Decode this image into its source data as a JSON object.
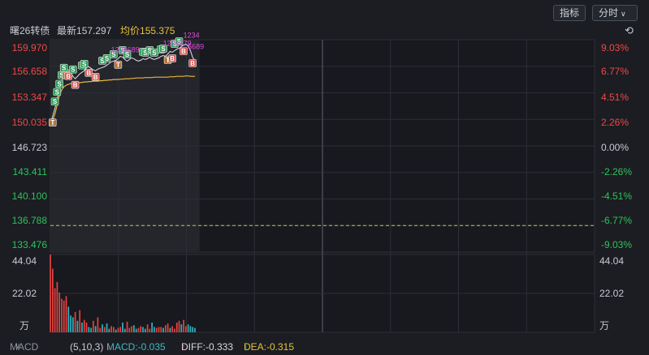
{
  "toolbar": {
    "indicator_label": "指标",
    "period_label": "分时",
    "period_icon": "chevron-down-icon"
  },
  "quote": {
    "name": "曙26转债",
    "latest_label": "最新",
    "latest_value": "157.297",
    "avg_label": "均价",
    "avg_value": "155.375",
    "refresh_icon": "refresh-icon"
  },
  "price_axis": {
    "left": [
      "159.970",
      "156.658",
      "153.347",
      "150.035",
      "146.723",
      "143.411",
      "140.100",
      "136.788",
      "133.476"
    ],
    "right": [
      "9.03%",
      "6.77%",
      "4.51%",
      "2.26%",
      "0.00%",
      "-2.26%",
      "-4.51%",
      "-6.77%",
      "-9.03%"
    ]
  },
  "volume_axis": {
    "left_top": "44.04",
    "left_mid": "22.02",
    "left_unit": "万",
    "right_top": "44.04",
    "right_mid": "22.02",
    "right_unit": "万"
  },
  "footer": {
    "indicator": "MACD",
    "indicator_icon": "chevron-down-icon",
    "params": "(5,10,3)",
    "macd": "MACD:-0.035",
    "diff": "DIFF:-0.333",
    "dea": "DEA:-0.315"
  },
  "chart_data": {
    "type": "line",
    "ylim": [
      133.476,
      159.97
    ],
    "reference_price": 146.723,
    "dashed_level": 136.788,
    "series": [
      {
        "values": [
          149.6,
          150.4,
          151.4,
          152.6,
          153.6,
          154.7,
          155.6,
          156.3,
          156.2,
          155.9,
          155.4,
          155.1,
          155.4,
          155.7,
          155.9,
          156.1,
          156.5,
          156.6,
          156.4,
          156.2,
          156.1,
          156.3,
          156.4,
          156.5,
          156.6,
          156.8,
          157.0,
          157.2,
          157.3,
          157.4,
          157.6,
          157.9,
          157.8,
          157.5,
          157.3,
          157.5,
          157.7,
          157.6,
          157.4,
          157.3,
          157.4,
          157.6,
          157.5,
          157.6,
          157.8,
          157.6,
          157.5,
          157.6,
          157.7,
          157.9,
          158.0,
          157.9,
          158.2,
          158.5,
          158.4,
          158.6,
          158.8,
          158.9,
          159.1,
          159.3,
          159.4,
          159.2,
          158.6,
          157.8,
          157.297
        ]
      },
      {
        "values": [
          149.6,
          149.9,
          150.7,
          151.8,
          153.0,
          153.7,
          154.1,
          154.3,
          154.4,
          154.5,
          154.5,
          154.55,
          154.6,
          154.6,
          154.65,
          154.7,
          154.7,
          154.75,
          154.75,
          154.8,
          154.8,
          154.8,
          154.85,
          154.85,
          154.9,
          154.9,
          154.95,
          154.95,
          155.0,
          155.0,
          155.0,
          155.05,
          155.05,
          155.1,
          155.1,
          155.1,
          155.15,
          155.15,
          155.2,
          155.2,
          155.2,
          155.2,
          155.25,
          155.25,
          155.25,
          155.25,
          155.3,
          155.3,
          155.3,
          155.3,
          155.3,
          155.3,
          155.3,
          155.35,
          155.35,
          155.35,
          155.4,
          155.4,
          155.4,
          155.4,
          155.45,
          155.45,
          155.4,
          155.4,
          155.375
        ]
      }
    ],
    "volume": {
      "ylim": [
        0,
        44.04
      ],
      "values": [
        44.0,
        36.0,
        25.0,
        28.5,
        22.5,
        19.0,
        18.0,
        20.5,
        14.5,
        9.5,
        8.5,
        11.5,
        6.5,
        12.5,
        5.5,
        7.0,
        5.5,
        3.0,
        2.5,
        6.5,
        3.5,
        8.5,
        2.5,
        4.5,
        3.0,
        5.0,
        2.0,
        3.5,
        3.0,
        1.5,
        2.5,
        3.0,
        5.5,
        2.0,
        6.0,
        2.5,
        3.5,
        4.0,
        2.0,
        2.5,
        3.5,
        3.0,
        2.0,
        4.5,
        2.0,
        5.5,
        3.0,
        2.5,
        3.0,
        3.0,
        2.5,
        4.0,
        5.0,
        2.5,
        3.5,
        2.0,
        5.5,
        6.5,
        4.5,
        7.0,
        3.5,
        4.5,
        3.5,
        3.0,
        2.5
      ],
      "directions": [
        "up",
        "up",
        "up",
        "up",
        "up",
        "up",
        "up",
        "up",
        "down",
        "down",
        "down",
        "up",
        "down",
        "up",
        "down",
        "up",
        "up",
        "down",
        "down",
        "up",
        "down",
        "up",
        "up",
        "down",
        "up",
        "down",
        "down",
        "up",
        "up",
        "down",
        "up",
        "up",
        "down",
        "down",
        "up",
        "up",
        "up",
        "down",
        "down",
        "up",
        "up",
        "down",
        "down",
        "up",
        "up",
        "down",
        "down",
        "up",
        "up",
        "up",
        "down",
        "up",
        "up",
        "down",
        "up",
        "up",
        "up",
        "up",
        "down",
        "up",
        "up",
        "down",
        "down",
        "down",
        "down"
      ]
    },
    "trade_markers": [
      {
        "i": 1,
        "label": "T",
        "kind": "sell",
        "level": 0
      },
      {
        "i": 2,
        "label": "S",
        "kind": "buy",
        "level": 1
      },
      {
        "i": 3,
        "label": "S",
        "kind": "buy",
        "level": 1
      },
      {
        "i": 4,
        "label": "S",
        "kind": "buy",
        "level": 1
      },
      {
        "i": 5,
        "label": "S",
        "kind": "buy",
        "level": 1
      },
      {
        "i": 6,
        "label": "S",
        "kind": "buy",
        "level": 1
      },
      {
        "i": 7,
        "label": "T",
        "kind": "sell",
        "level": 0
      },
      {
        "i": 8,
        "label": "B",
        "kind": "sell",
        "level": 0
      },
      {
        "i": 10,
        "label": "S",
        "kind": "buy",
        "level": 1
      },
      {
        "i": 11,
        "label": "B",
        "kind": "sell",
        "level": 0
      },
      {
        "i": 14,
        "label": "S",
        "kind": "buy",
        "level": 1
      },
      {
        "i": 15,
        "label": "S",
        "kind": "buy",
        "level": 1
      },
      {
        "i": 17,
        "label": "B",
        "kind": "sell",
        "level": 0
      },
      {
        "i": 20,
        "label": "B",
        "kind": "sell",
        "level": 0
      },
      {
        "i": 23,
        "label": "S",
        "kind": "buy",
        "level": 1
      },
      {
        "i": 25,
        "label": "S",
        "kind": "buy",
        "level": 1
      },
      {
        "i": 28,
        "label": "S",
        "kind": "buy",
        "level": 1
      },
      {
        "i": 30,
        "label": "T",
        "kind": "sell",
        "level": 0
      },
      {
        "i": 32,
        "label": "S",
        "kind": "buy",
        "level": 1
      },
      {
        "i": 34,
        "label": "S",
        "kind": "buy",
        "level": 1
      },
      {
        "i": 41,
        "label": "S",
        "kind": "buy",
        "level": 1
      },
      {
        "i": 42,
        "label": "S",
        "kind": "buy",
        "level": 1
      },
      {
        "i": 44,
        "label": "S",
        "kind": "buy",
        "level": 1
      },
      {
        "i": 46,
        "label": "S",
        "kind": "buy",
        "level": 1
      },
      {
        "i": 49,
        "label": "S",
        "kind": "buy",
        "level": 1
      },
      {
        "i": 50,
        "label": "S",
        "kind": "buy",
        "level": 1
      },
      {
        "i": 52,
        "label": "T",
        "kind": "sell",
        "level": 0
      },
      {
        "i": 54,
        "label": "B",
        "kind": "sell",
        "level": 0
      },
      {
        "i": 55,
        "label": "S",
        "kind": "buy",
        "level": 1
      },
      {
        "i": 57,
        "label": "S",
        "kind": "buy",
        "level": 1
      },
      {
        "i": 59,
        "label": "B",
        "kind": "sell",
        "level": 0
      },
      {
        "i": 63,
        "label": "B",
        "kind": "sell",
        "level": 0
      }
    ],
    "annotations": [
      {
        "i": 29,
        "text": "1234689"
      },
      {
        "i": 52,
        "text": "1234679"
      },
      {
        "i": 61,
        "text": "1234"
      },
      {
        "i": 63,
        "text": "5689"
      }
    ]
  }
}
